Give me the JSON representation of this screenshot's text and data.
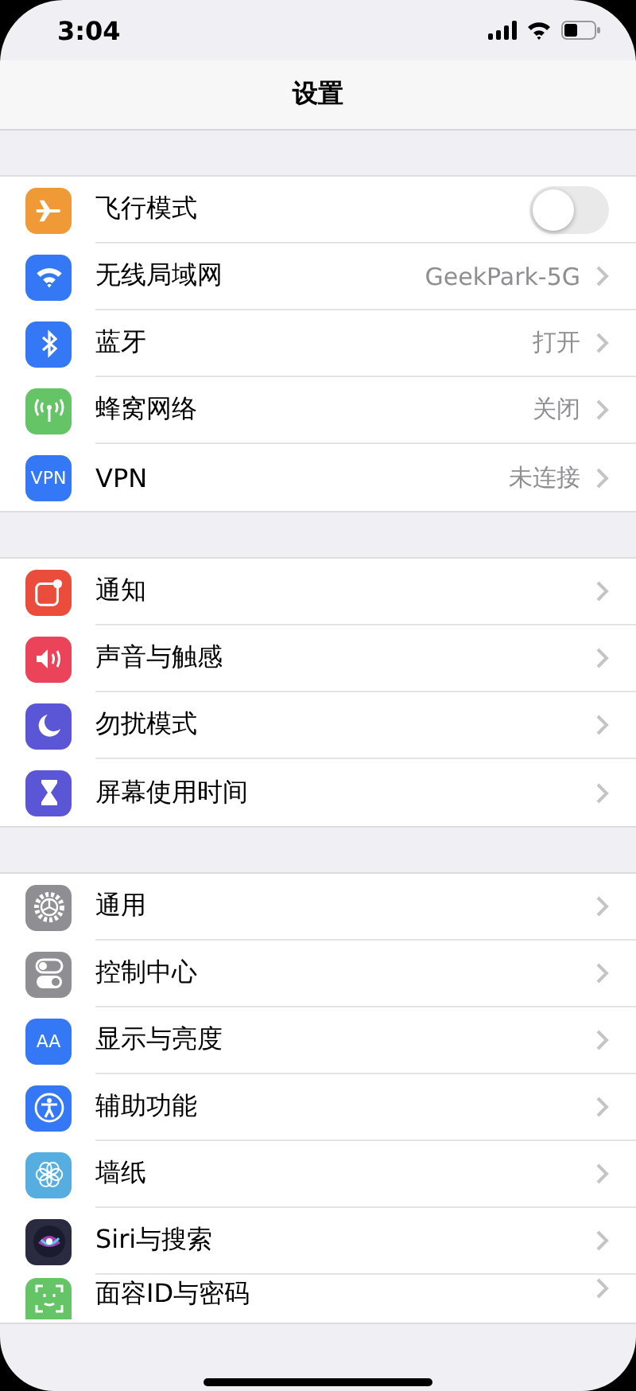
{
  "status_bar": {
    "time": "3:04"
  },
  "nav": {
    "title": "设置"
  },
  "sections": [
    {
      "rows": [
        {
          "kind": "toggle",
          "label": "飞行模式",
          "color": "#f09a37",
          "on": false
        },
        {
          "kind": "link",
          "label": "无线局域网",
          "color": "#3478f6",
          "value": "GeekPark-5G"
        },
        {
          "kind": "link",
          "label": "蓝牙",
          "color": "#3478f6",
          "value": "打开"
        },
        {
          "kind": "link",
          "label": "蜂窝网络",
          "color": "#65c466",
          "value": "关闭"
        },
        {
          "kind": "link",
          "label": "VPN",
          "color": "#3478f6",
          "value": "未连接",
          "badge": "VPN"
        }
      ]
    },
    {
      "rows": [
        {
          "kind": "link",
          "label": "通知",
          "color": "#eb4d3d"
        },
        {
          "kind": "link",
          "label": "声音与触感",
          "color": "#eb445a"
        },
        {
          "kind": "link",
          "label": "勿扰模式",
          "color": "#5b56d6"
        },
        {
          "kind": "link",
          "label": "屏幕使用时间",
          "color": "#5b56d6"
        }
      ]
    },
    {
      "rows": [
        {
          "kind": "link",
          "label": "通用",
          "color": "#8e8e93"
        },
        {
          "kind": "link",
          "label": "控制中心",
          "color": "#8e8e93"
        },
        {
          "kind": "link",
          "label": "显示与亮度",
          "color": "#3478f6",
          "badge": "AA"
        },
        {
          "kind": "link",
          "label": "辅助功能",
          "color": "#3478f6"
        },
        {
          "kind": "link",
          "label": "墙纸",
          "color": "#56aee0"
        },
        {
          "kind": "link",
          "label": "Siri与搜索",
          "color": "#2a2a40"
        },
        {
          "kind": "link",
          "label": "面容ID与密码",
          "color": "#65c466"
        }
      ]
    }
  ]
}
